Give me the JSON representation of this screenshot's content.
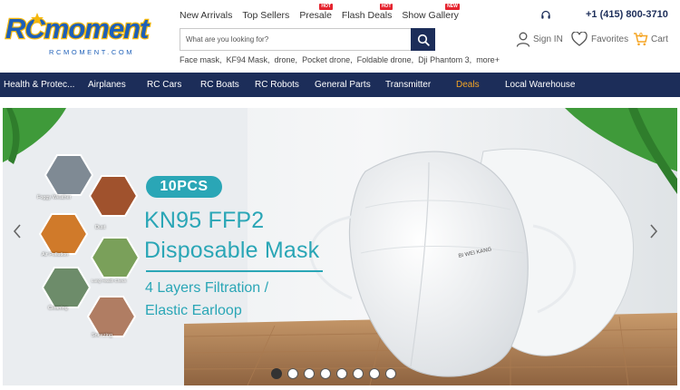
{
  "header": {
    "logo_text": "RCmoment",
    "logo_sub": "RCMOMENT.COM",
    "topnav": [
      {
        "label": "New Arrivals",
        "badge": ""
      },
      {
        "label": "Top Sellers",
        "badge": ""
      },
      {
        "label": "Presale",
        "badge": "HOT"
      },
      {
        "label": "Flash Deals",
        "badge": "HOT"
      },
      {
        "label": "Show Gallery",
        "badge": "NEW"
      }
    ],
    "search": {
      "placeholder": "What are you looking for?"
    },
    "hot_searches": [
      "Face mask,",
      "KF94 Mask,",
      "drone,",
      "Pocket drone,",
      "Foldable drone,",
      "Dji Phantom 3,",
      "more+"
    ],
    "phone": "+1  (415)  800-3710",
    "account": {
      "sign_in": "Sign IN",
      "favorites": "Favorites",
      "cart": "Cart",
      "cart_count": "0"
    }
  },
  "categories": [
    "Health & Protec...",
    "Airplanes",
    "RC Cars",
    "RC Boats",
    "RC Robots",
    "General Parts",
    "Transmitter",
    "Deals",
    "Local Warehouse"
  ],
  "banner": {
    "tag": "10PCS",
    "headline1": "KN95 FFP2",
    "headline2": "Disposable Mask",
    "sub1": "4 Layers Filtration /",
    "sub2": "Elastic Earloop",
    "mask_print": "BI WEI KANG",
    "hex_labels": [
      "Foggy Weather",
      "Dust",
      "Air Pollution",
      "Lung Health Check",
      "Cleaning",
      "Sneezing"
    ],
    "slides": 8,
    "active_slide": 1
  },
  "colors": {
    "navy": "#1c2d59",
    "teal": "#2aa6b6",
    "deals": "#f5a524",
    "badge": "#e5232e"
  }
}
